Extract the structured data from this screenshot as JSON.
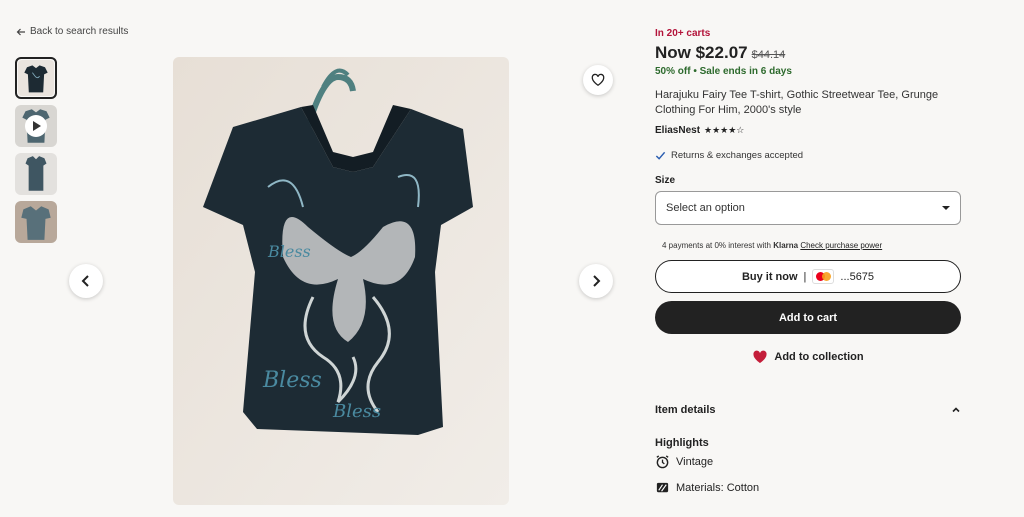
{
  "nav": {
    "back_label": "Back to search results"
  },
  "listing": {
    "carts": "In 20+ carts",
    "price": "Now $22.07",
    "old_price": "$44.14",
    "discount": "50% off",
    "sale_ends": "Sale ends in 6 days",
    "title": "Harajuku Fairy Tee T-shirt, Gothic Streetwear Tee, Grunge Clothing For Him, 2000's style",
    "shop_name": "EliasNest",
    "rating_stars": "★★★★☆",
    "returns": "Returns & exchanges accepted"
  },
  "size": {
    "label": "Size",
    "placeholder": "Select an option"
  },
  "klarna": {
    "prefix": "4 payments at 0% interest with",
    "brand": "Klarna",
    "link": "Check purchase power"
  },
  "buttons": {
    "buy_now": "Buy it now",
    "card_last4": "...5675",
    "add_to_cart": "Add to cart",
    "add_to_collection": "Add to collection"
  },
  "details": {
    "heading": "Item details",
    "highlights": "Highlights",
    "items": [
      "Vintage",
      "Materials: Cotton"
    ]
  },
  "colors": {
    "accent_red": "#b3133a",
    "sale_green": "#2d6a2d",
    "button_dark": "#222222",
    "background": "#f8f7f5"
  }
}
